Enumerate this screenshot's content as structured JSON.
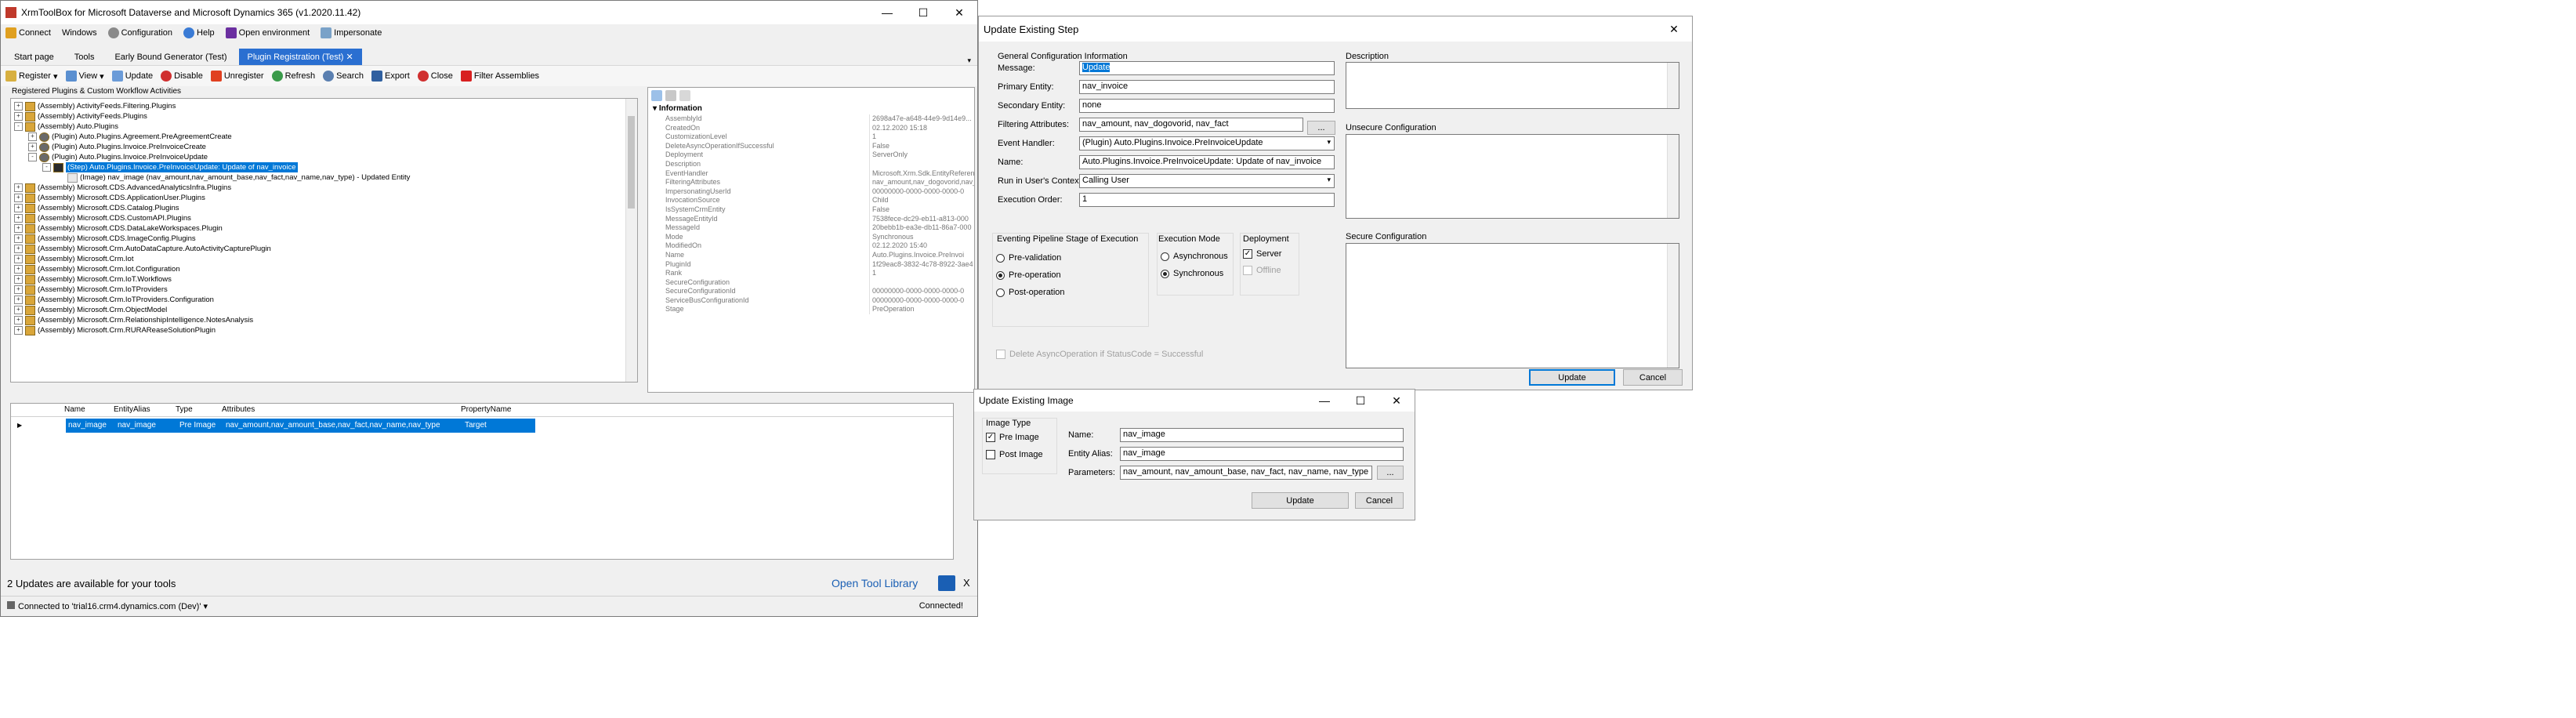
{
  "main_window": {
    "title": "XrmToolBox for Microsoft Dataverse and Microsoft Dynamics 365 (v1.2020.11.42)",
    "menu": [
      "Connect",
      "Windows",
      "Configuration",
      "Help",
      "Open environment",
      "Impersonate"
    ],
    "tabs": [
      "Start page",
      "Tools",
      "Early Bound Generator (Test)",
      "Plugin Registration (Test)"
    ],
    "active_tab_close": "✕",
    "toolbar": [
      "Register",
      "View",
      "Update",
      "Disable",
      "Unregister",
      "Refresh",
      "Search",
      "Export",
      "Close",
      "Filter Assemblies"
    ],
    "panel_caption": "Registered Plugins & Custom Workflow Activities",
    "tree": [
      {
        "indent": 0,
        "exp": "+",
        "text": "(Assembly) ActivityFeeds.Filtering.Plugins"
      },
      {
        "indent": 0,
        "exp": "+",
        "text": "(Assembly) ActivityFeeds.Plugins"
      },
      {
        "indent": 0,
        "exp": "-",
        "text": "(Assembly) Auto.Plugins"
      },
      {
        "indent": 1,
        "exp": "+",
        "text": "(Plugin) Auto.Plugins.Agreement.PreAgreementCreate"
      },
      {
        "indent": 1,
        "exp": "+",
        "text": "(Plugin) Auto.Plugins.Invoice.PreInvoiceCreate"
      },
      {
        "indent": 1,
        "exp": "-",
        "text": "(Plugin) Auto.Plugins.Invoice.PreInvoiceUpdate"
      },
      {
        "indent": 2,
        "exp": "-",
        "text": "(Step) Auto.Plugins.Invoice.PreInvoiceUpdate: Update of nav_invoice",
        "selected": true
      },
      {
        "indent": 3,
        "exp": "",
        "text": "(Image) nav_image (nav_amount,nav_amount_base,nav_fact,nav_name,nav_type) - Updated Entity"
      },
      {
        "indent": 0,
        "exp": "+",
        "text": "(Assembly) Microsoft.CDS.AdvancedAnalyticsInfra.Plugins"
      },
      {
        "indent": 0,
        "exp": "+",
        "text": "(Assembly) Microsoft.CDS.ApplicationUser.Plugins"
      },
      {
        "indent": 0,
        "exp": "+",
        "text": "(Assembly) Microsoft.CDS.Catalog.Plugins"
      },
      {
        "indent": 0,
        "exp": "+",
        "text": "(Assembly) Microsoft.CDS.CustomAPI.Plugins"
      },
      {
        "indent": 0,
        "exp": "+",
        "text": "(Assembly) Microsoft.CDS.DataLakeWorkspaces.Plugin"
      },
      {
        "indent": 0,
        "exp": "+",
        "text": "(Assembly) Microsoft.CDS.ImageConfig.Plugins"
      },
      {
        "indent": 0,
        "exp": "+",
        "text": "(Assembly) Microsoft.Crm.AutoDataCapture.AutoActivityCapturePlugin"
      },
      {
        "indent": 0,
        "exp": "+",
        "text": "(Assembly) Microsoft.Crm.Iot"
      },
      {
        "indent": 0,
        "exp": "+",
        "text": "(Assembly) Microsoft.Crm.Iot.Configuration"
      },
      {
        "indent": 0,
        "exp": "+",
        "text": "(Assembly) Microsoft.Crm.IoT.Workflows"
      },
      {
        "indent": 0,
        "exp": "+",
        "text": "(Assembly) Microsoft.Crm.IoTProviders"
      },
      {
        "indent": 0,
        "exp": "+",
        "text": "(Assembly) Microsoft.Crm.IoTProviders.Configuration"
      },
      {
        "indent": 0,
        "exp": "+",
        "text": "(Assembly) Microsoft.Crm.ObjectModel"
      },
      {
        "indent": 0,
        "exp": "+",
        "text": "(Assembly) Microsoft.Crm.RelationshipIntelligence.NotesAnalysis"
      },
      {
        "indent": 0,
        "exp": "+",
        "text": "(Assembly) Microsoft.Crm.RURAReaseSolutionPlugin"
      }
    ],
    "properties_header": "Information",
    "properties": [
      {
        "k": "AssemblyId",
        "v": "2698a47e-a648-44e9-9d14e9..."
      },
      {
        "k": "CreatedOn",
        "v": "02.12.2020 15:18"
      },
      {
        "k": "CustomizationLevel",
        "v": "1"
      },
      {
        "k": "DeleteAsyncOperationIfSuccessful",
        "v": "False"
      },
      {
        "k": "Deployment",
        "v": "ServerOnly"
      },
      {
        "k": "Description",
        "v": ""
      },
      {
        "k": "EventHandler",
        "v": "Microsoft.Xrm.Sdk.EntityReferen"
      },
      {
        "k": "FilteringAttributes",
        "v": "nav_amount,nav_dogovorid,nav_"
      },
      {
        "k": "ImpersonatingUserId",
        "v": "00000000-0000-0000-0000-0"
      },
      {
        "k": "InvocationSource",
        "v": "Child"
      },
      {
        "k": "IsSystemCrmEntity",
        "v": "False"
      },
      {
        "k": "MessageEntityId",
        "v": "7538fece-dc29-eb11-a813-000"
      },
      {
        "k": "MessageId",
        "v": "20bebb1b-ea3e-db11-86a7-000"
      },
      {
        "k": "Mode",
        "v": "Synchronous"
      },
      {
        "k": "ModifiedOn",
        "v": "02.12.2020 15:40"
      },
      {
        "k": "Name",
        "v": "Auto.Plugins.Invoice.PreInvoi"
      },
      {
        "k": "PluginId",
        "v": "1f29eac8-3832-4c78-8922-3ae4"
      },
      {
        "k": "Rank",
        "v": "1"
      },
      {
        "k": "SecureConfiguration",
        "v": ""
      },
      {
        "k": "SecureConfigurationId",
        "v": "00000000-0000-0000-0000-0"
      },
      {
        "k": "ServiceBusConfigurationId",
        "v": "00000000-0000-0000-0000-0"
      },
      {
        "k": "Stage",
        "v": "PreOperation"
      }
    ],
    "image_grid": {
      "columns": [
        "Name",
        "EntityAlias",
        "Type",
        "Attributes",
        "PropertyName"
      ],
      "row": [
        "nav_image",
        "nav_image",
        "Pre Image",
        "nav_amount,nav_amount_base,nav_fact,nav_name,nav_type",
        "Target"
      ]
    },
    "updates_text": "2 Updates are available for your tools",
    "open_library": "Open Tool Library",
    "status_left": "Connected to 'trial16.crm4.dynamics.com (Dev)'",
    "status_right": "Connected!"
  },
  "step_dialog": {
    "title": "Update Existing Step",
    "general_label": "General Configuration Information",
    "fields": [
      {
        "label": "Message:",
        "value": "Update"
      },
      {
        "label": "Primary Entity:",
        "value": "nav_invoice"
      },
      {
        "label": "Secondary Entity:",
        "value": "none"
      },
      {
        "label": "Filtering Attributes:",
        "value": "nav_amount, nav_dogovorid, nav_fact"
      },
      {
        "label": "Event Handler:",
        "value": "(Plugin) Auto.Plugins.Invoice.PreInvoiceUpdate"
      },
      {
        "label": "Name:",
        "value": "Auto.Plugins.Invoice.PreInvoiceUpdate: Update of nav_invoice"
      },
      {
        "label": "Run in User's Context:",
        "value": "Calling User"
      },
      {
        "label": "Execution Order:",
        "value": "1"
      }
    ],
    "ellipsis": "...",
    "stage_label": "Eventing Pipeline Stage of Execution",
    "stages": [
      "Pre-validation",
      "Pre-operation",
      "Post-operation"
    ],
    "stage_selected": 1,
    "mode_label": "Execution Mode",
    "modes": [
      "Asynchronous",
      "Synchronous"
    ],
    "mode_selected": 1,
    "deploy_label": "Deployment",
    "deploy": [
      "Server",
      "Offline"
    ],
    "delete_async": "Delete AsyncOperation if StatusCode = Successful",
    "description_label": "Description",
    "unsecure_label": "Unsecure Configuration",
    "secure_label": "Secure Configuration",
    "update_btn": "Update",
    "cancel_btn": "Cancel"
  },
  "image_dialog": {
    "title": "Update Existing Image",
    "type_label": "Image Type",
    "pre": "Pre Image",
    "post": "Post Image",
    "name_label": "Name:",
    "name_value": "nav_image",
    "alias_label": "Entity Alias:",
    "alias_value": "nav_image",
    "params_label": "Parameters:",
    "params_value": "nav_amount, nav_amount_base, nav_fact, nav_name, nav_type",
    "ellipsis": "...",
    "update_btn": "Update",
    "cancel_btn": "Cancel"
  },
  "win_ctl": {
    "min": "—",
    "max": "☐",
    "close": "✕"
  },
  "colors": {
    "accent": "#0078d7",
    "selection": "#0078d7",
    "tab_active": "#2a6fd1",
    "link": "#1a5fb4"
  }
}
